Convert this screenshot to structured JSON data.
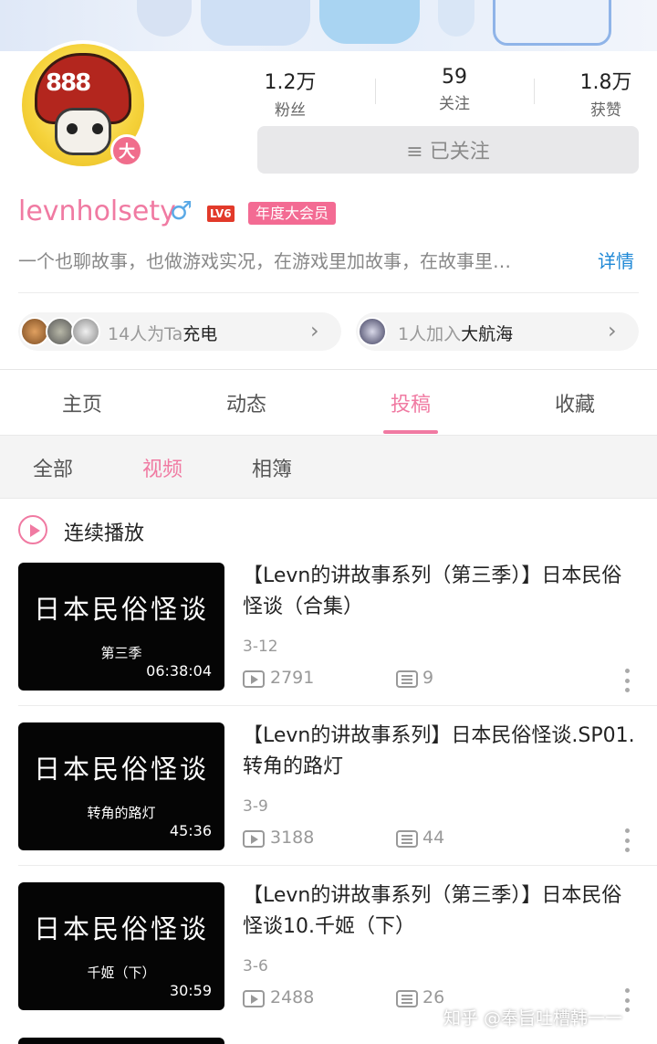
{
  "profile": {
    "username": "levnholsety",
    "gender_symbol": "♂",
    "level": "LV6",
    "vip_badge": "年度大会员",
    "avatar_badge": "大",
    "avatar_number": "888",
    "bio": "一个也聊故事，也做游戏实况，在游戏里加故事，在故事里…",
    "detail_link": "详情",
    "follow_button": "≡ 已关注"
  },
  "stats": [
    {
      "value": "1.2万",
      "label": "粉丝"
    },
    {
      "value": "59",
      "label": "关注"
    },
    {
      "value": "1.8万",
      "label": "获赞"
    }
  ],
  "charge": {
    "text": "14人为Ta",
    "highlight": "充电"
  },
  "fleet": {
    "text": "1人加入",
    "highlight": "大航海"
  },
  "tabs": [
    {
      "label": "主页"
    },
    {
      "label": "动态"
    },
    {
      "label": "投稿"
    },
    {
      "label": "收藏"
    }
  ],
  "active_tab": "投稿",
  "subtabs": [
    {
      "label": "全部"
    },
    {
      "label": "视频"
    },
    {
      "label": "相簿"
    }
  ],
  "active_subtab": "视频",
  "continuous_play": "连续播放",
  "videos": [
    {
      "title": "【Levn的讲故事系列（第三季）】日本民俗怪谈（合集）",
      "thumb_title": "日本民俗怪谈",
      "thumb_subtitle": "第三季",
      "duration": "06:38:04",
      "date": "3-12",
      "plays": "2791",
      "count": "9"
    },
    {
      "title": "【Levn的讲故事系列】日本民俗怪谈.SP01.转角的路灯",
      "thumb_title": "日本民俗怪谈",
      "thumb_subtitle": "转角的路灯",
      "duration": "45:36",
      "date": "3-9",
      "plays": "3188",
      "count": "44"
    },
    {
      "title": "【Levn的讲故事系列（第三季）】日本民俗怪谈10.千姬（下）",
      "thumb_title": "日本民俗怪谈",
      "thumb_subtitle": "千姬（下）",
      "duration": "30:59",
      "date": "3-6",
      "plays": "2488",
      "count": "26"
    }
  ],
  "watermark": "知乎 @奉旨吐槽韩一一",
  "colors": {
    "accent_pink": "#f07aa2",
    "vip_pink": "#f36b93",
    "link_blue": "#1e88d6",
    "level_red": "#e23a2a"
  }
}
